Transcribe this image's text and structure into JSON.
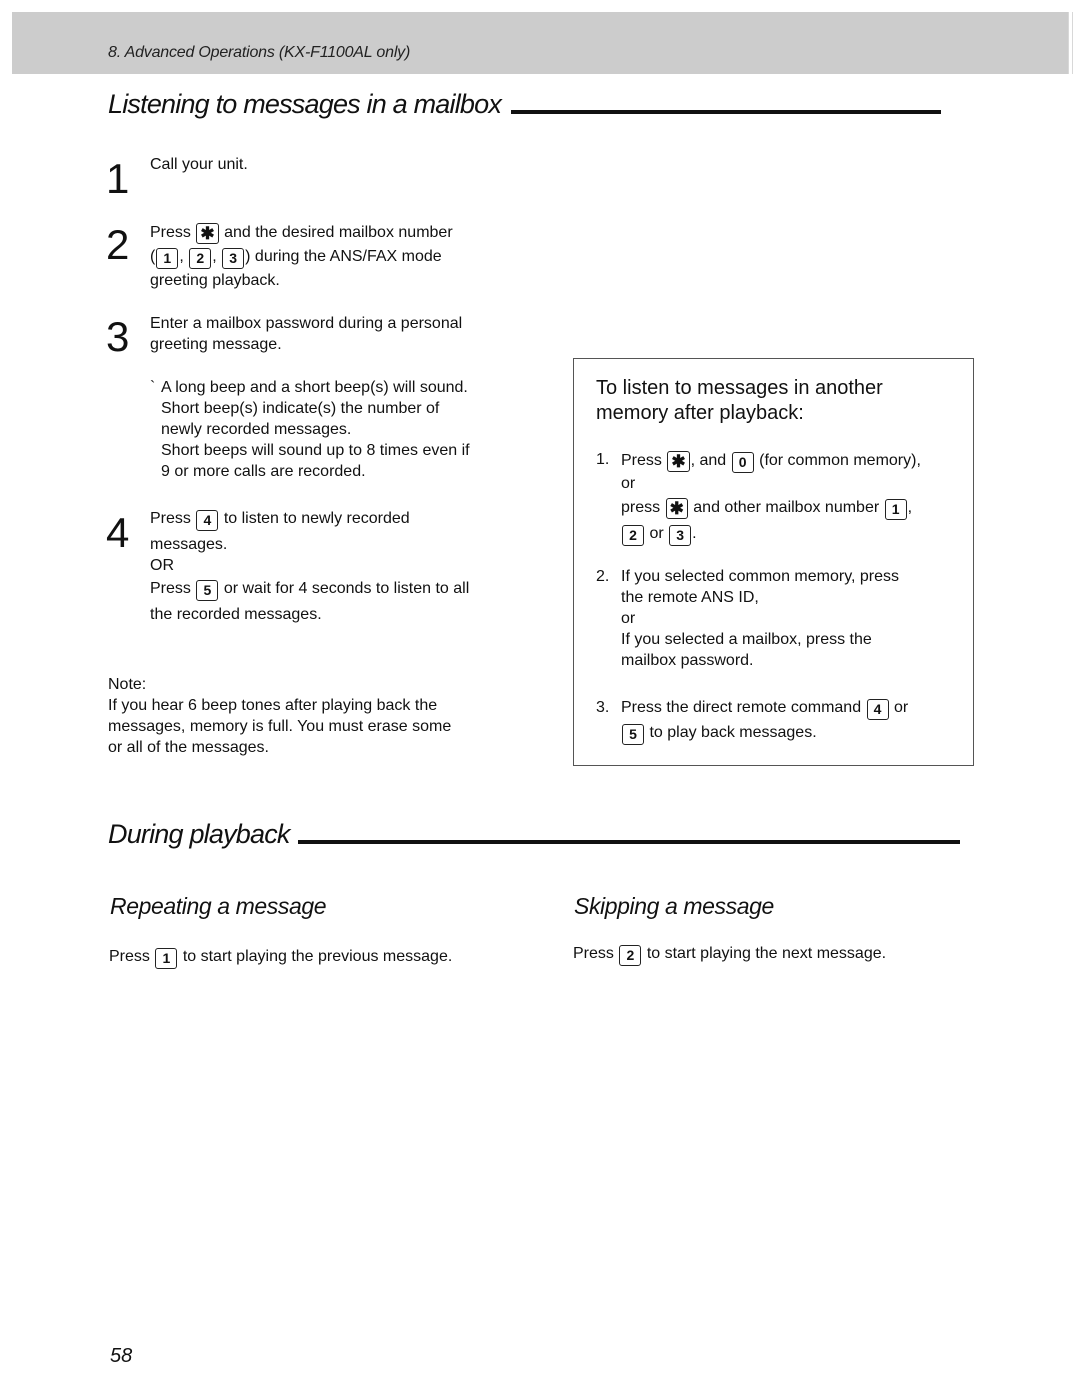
{
  "header": {
    "chapter": "8.  Advanced Operations (KX-F1100AL only)"
  },
  "section1": {
    "title": "Listening to messages in a mailbox",
    "steps": [
      {
        "number": "1",
        "text": "Call your unit."
      },
      {
        "number": "2",
        "line1_prefix": "Press",
        "line1_key": "✱",
        "line1_suffix": "and the desired mailbox number",
        "line2_open": "(",
        "line2_keys": [
          "1",
          "2",
          "3"
        ],
        "line2_sep": ",",
        "line2_suffix": ") during the ANS/FAX mode",
        "line3": "greeting playback."
      },
      {
        "number": "3",
        "line1": "Enter a mailbox password during a personal",
        "line2": "greeting message."
      },
      {
        "number": "4",
        "line1_prefix": "Press",
        "line1_key": "4",
        "line1_suffix": "to listen to newly recorded",
        "line2": "messages.",
        "or": "OR",
        "line3_prefix": "Press",
        "line3_key": "5",
        "line3_suffix": "or wait for 4 seconds to listen to all",
        "line4": "the recorded messages."
      }
    ],
    "bullet": {
      "marker": "`",
      "lines": [
        "A long beep and a short beep(s) will sound.",
        "Short beep(s) indicate(s) the number of",
        "newly recorded messages.",
        "Short beeps will sound up to 8 times even if",
        "9 or more calls are recorded."
      ]
    },
    "note": {
      "label": "Note:",
      "lines": [
        "If you hear 6 beep tones after playing back the",
        "messages, memory is full. You must erase some",
        "or all of the messages."
      ]
    }
  },
  "info_box": {
    "title_line1": "To listen to messages in another",
    "title_line2": "memory after playback:",
    "item1": {
      "num": "1.",
      "a_prefix": "Press",
      "a_key1": "✱",
      "a_mid": ", and",
      "a_key2": "0",
      "a_suffix": "(for common memory),",
      "or": "or",
      "b_prefix": "press",
      "b_key1": "✱",
      "b_mid": "and other mailbox number",
      "b_key2": "1",
      "b_comma": ",",
      "c_key1": "2",
      "c_mid": "or",
      "c_key2": "3",
      "c_end": "."
    },
    "item2": {
      "num": "2.",
      "lines": [
        "If you selected common memory, press",
        "the remote ANS ID,",
        "or",
        "If you selected a mailbox, press the",
        "mailbox password."
      ]
    },
    "item3": {
      "num": "3.",
      "a_prefix": "Press the direct remote command",
      "a_key": "4",
      "a_suffix": "or",
      "b_key": "5",
      "b_suffix": "to play back messages."
    }
  },
  "section2": {
    "title": "During playback",
    "repeat": {
      "title": "Repeating a message",
      "prefix": "Press",
      "key": "1",
      "suffix": "to start playing the previous message."
    },
    "skip": {
      "title": "Skipping a message",
      "prefix": "Press",
      "key": "2",
      "suffix": "to start playing the next message."
    }
  },
  "footer": {
    "page_number": "58"
  }
}
